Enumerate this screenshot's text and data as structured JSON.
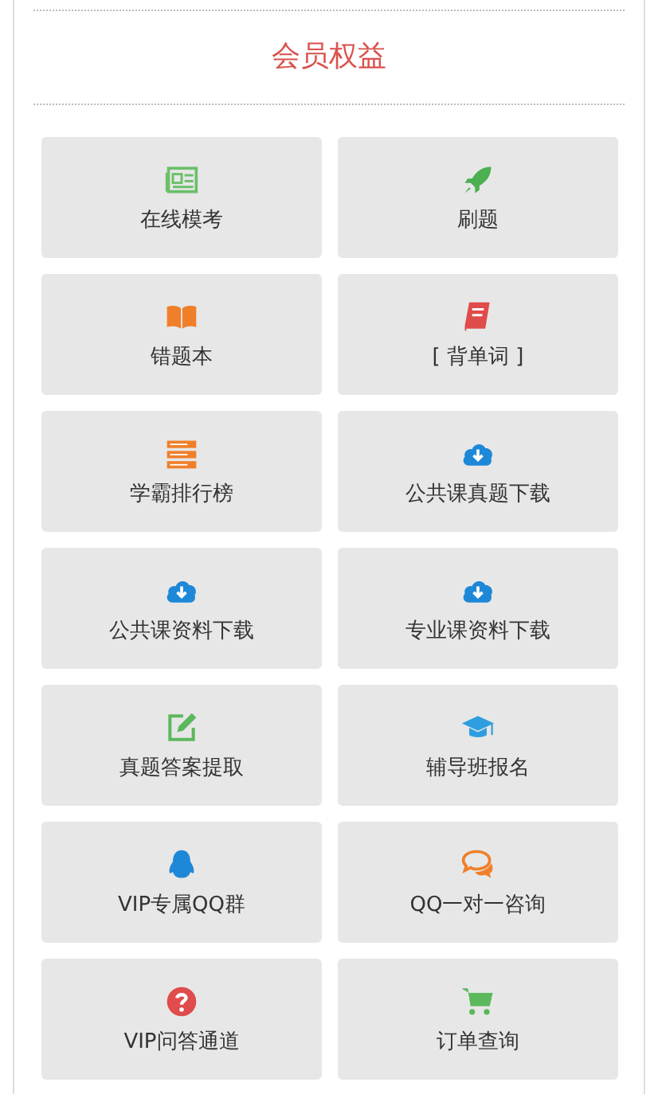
{
  "section": {
    "title": "会员权益"
  },
  "items": [
    {
      "label": "在线模考",
      "kind": "newspaper",
      "color": "#6abf69"
    },
    {
      "label": "刷题",
      "kind": "rocket",
      "color": "#4caf50"
    },
    {
      "label": "错题本",
      "kind": "openbook",
      "color": "#f07f2a"
    },
    {
      "label": "[ 背单词 ]",
      "kind": "book",
      "color": "#e04b4b"
    },
    {
      "label": "学霸排行榜",
      "kind": "stack",
      "color": "#f07f2a"
    },
    {
      "label": "公共课真题下载",
      "kind": "download",
      "color": "#1e88d8"
    },
    {
      "label": "公共课资料下载",
      "kind": "download",
      "color": "#1e88d8"
    },
    {
      "label": "专业课资料下载",
      "kind": "download",
      "color": "#1e88d8"
    },
    {
      "label": "真题答案提取",
      "kind": "edit",
      "color": "#5cb85c"
    },
    {
      "label": "辅导班报名",
      "kind": "cap",
      "color": "#2f9ee0"
    },
    {
      "label": "VIP专属QQ群",
      "kind": "penguin",
      "color": "#1e88d8"
    },
    {
      "label": "QQ一对一咨询",
      "kind": "chat",
      "color": "#f07f2a"
    },
    {
      "label": "VIP问答通道",
      "kind": "question",
      "color": "#e04b4b"
    },
    {
      "label": "订单查询",
      "kind": "cart",
      "color": "#5cb85c"
    }
  ]
}
